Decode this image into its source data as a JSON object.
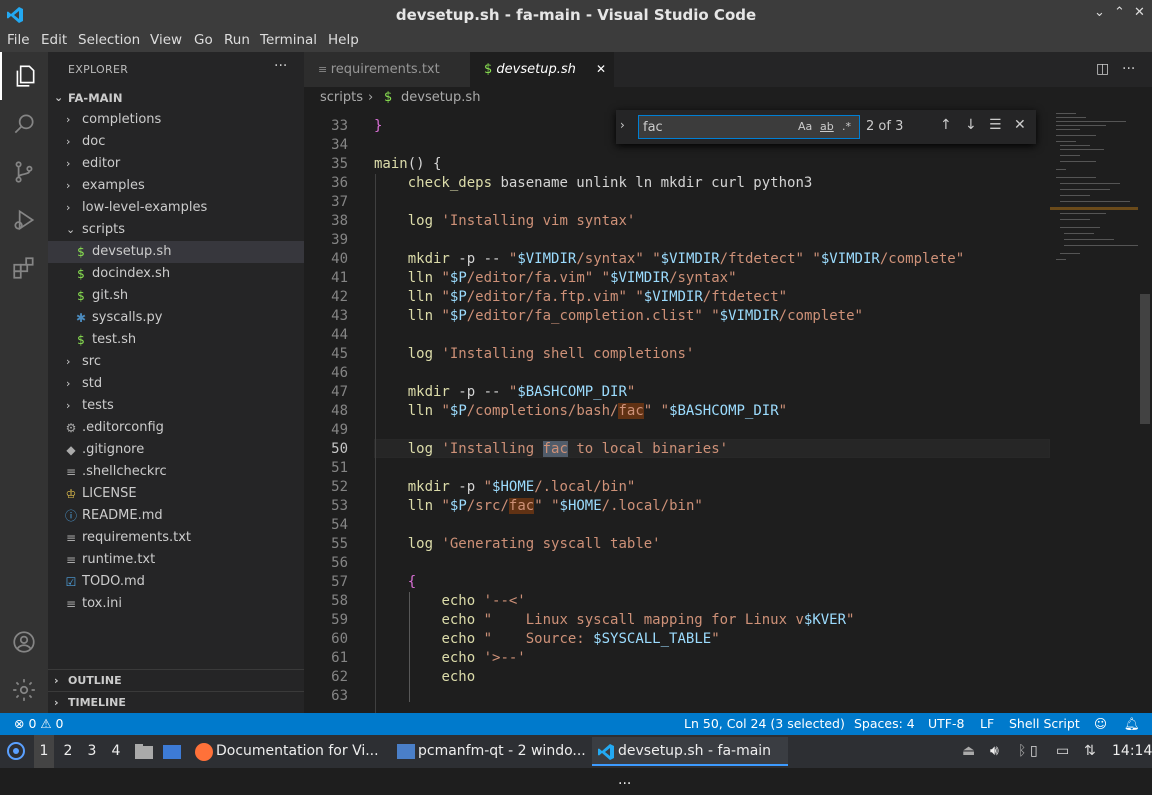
{
  "window": {
    "title": "devsetup.sh - fa-main - Visual Studio Code",
    "controls": [
      "⌄",
      "⌃",
      "✕"
    ]
  },
  "menu": [
    "File",
    "Edit",
    "Selection",
    "View",
    "Go",
    "Run",
    "Terminal",
    "Help"
  ],
  "sidebar": {
    "header": "EXPLORER",
    "more": "···",
    "root": "FA-MAIN",
    "items": [
      {
        "label": "completions",
        "type": "folder",
        "open": false
      },
      {
        "label": "doc",
        "type": "folder",
        "open": false
      },
      {
        "label": "editor",
        "type": "folder",
        "open": false
      },
      {
        "label": "examples",
        "type": "folder",
        "open": false
      },
      {
        "label": "low-level-examples",
        "type": "folder",
        "open": false
      },
      {
        "label": "scripts",
        "type": "folder",
        "open": true
      },
      {
        "label": "devsetup.sh",
        "type": "sh",
        "selected": true
      },
      {
        "label": "docindex.sh",
        "type": "sh"
      },
      {
        "label": "git.sh",
        "type": "sh"
      },
      {
        "label": "syscalls.py",
        "type": "py"
      },
      {
        "label": "test.sh",
        "type": "sh"
      },
      {
        "label": "src",
        "type": "folder",
        "open": false
      },
      {
        "label": "std",
        "type": "folder",
        "open": false
      },
      {
        "label": "tests",
        "type": "folder",
        "open": false
      },
      {
        "label": ".editorconfig",
        "type": "gear"
      },
      {
        "label": ".gitignore",
        "type": "git"
      },
      {
        "label": ".shellcheckrc",
        "type": "lines"
      },
      {
        "label": "LICENSE",
        "type": "license"
      },
      {
        "label": "README.md",
        "type": "info"
      },
      {
        "label": "requirements.txt",
        "type": "lines"
      },
      {
        "label": "runtime.txt",
        "type": "lines"
      },
      {
        "label": "TODO.md",
        "type": "check"
      },
      {
        "label": "tox.ini",
        "type": "lines"
      }
    ],
    "outline": "OUTLINE",
    "timeline": "TIMELINE"
  },
  "tabs": [
    {
      "label": "requirements.txt",
      "active": false
    },
    {
      "label": "devsetup.sh",
      "active": true,
      "close": "✕"
    }
  ],
  "breadcrumb": {
    "folder": "scripts",
    "sep": "›",
    "file": "devsetup.sh"
  },
  "find": {
    "value": "fac",
    "count": "2 of 3",
    "case": "Aa",
    "word": "ab",
    "regex": ".*"
  },
  "editor": {
    "current_line": 50,
    "lines": [
      {
        "n": "33",
        "t": "}"
      },
      {
        "n": "34",
        "t": ""
      },
      {
        "n": "35",
        "t": "main() {"
      },
      {
        "n": "36",
        "t": "    check_deps basename unlink ln mkdir curl python3"
      },
      {
        "n": "37",
        "t": ""
      },
      {
        "n": "38",
        "t": "    log 'Installing vim syntax'"
      },
      {
        "n": "39",
        "t": ""
      },
      {
        "n": "40",
        "t": "    mkdir -p -- \"$VIMDIR/syntax\" \"$VIMDIR/ftdetect\" \"$VIMDIR/complete\""
      },
      {
        "n": "41",
        "t": "    lln \"$P/editor/fa.vim\" \"$VIMDIR/syntax\""
      },
      {
        "n": "42",
        "t": "    lln \"$P/editor/fa.ftp.vim\" \"$VIMDIR/ftdetect\""
      },
      {
        "n": "43",
        "t": "    lln \"$P/editor/fa_completion.clist\" \"$VIMDIR/complete\""
      },
      {
        "n": "44",
        "t": ""
      },
      {
        "n": "45",
        "t": "    log 'Installing shell completions'"
      },
      {
        "n": "46",
        "t": ""
      },
      {
        "n": "47",
        "t": "    mkdir -p -- \"$BASHCOMP_DIR\""
      },
      {
        "n": "48",
        "t": "    lln \"$P/completions/bash/fac\" \"$BASHCOMP_DIR\""
      },
      {
        "n": "49",
        "t": ""
      },
      {
        "n": "50",
        "t": "    log 'Installing fac to local binaries'"
      },
      {
        "n": "51",
        "t": ""
      },
      {
        "n": "52",
        "t": "    mkdir -p \"$HOME/.local/bin\""
      },
      {
        "n": "53",
        "t": "    lln \"$P/src/fac\" \"$HOME/.local/bin\""
      },
      {
        "n": "54",
        "t": ""
      },
      {
        "n": "55",
        "t": "    log 'Generating syscall table'"
      },
      {
        "n": "56",
        "t": ""
      },
      {
        "n": "57",
        "t": "    {"
      },
      {
        "n": "58",
        "t": "        echo '--<'"
      },
      {
        "n": "59",
        "t": "        echo \"    Linux syscall mapping for Linux v$KVER\""
      },
      {
        "n": "60",
        "t": "        echo \"    Source: $SYSCALL_TABLE\""
      },
      {
        "n": "61",
        "t": "        echo '>--'"
      },
      {
        "n": "62",
        "t": "        echo"
      },
      {
        "n": "63",
        "t": ""
      }
    ]
  },
  "status": {
    "remote": "⛒",
    "problems": "⊗ 0 ⚠ 0",
    "position": "Ln 50, Col 24 (3 selected)",
    "spaces": "Spaces: 4",
    "encoding": "UTF-8",
    "eol": "LF",
    "language": "Shell Script"
  },
  "taskbar": {
    "workspaces": [
      "1",
      "2",
      "3",
      "4"
    ],
    "windows": [
      {
        "label": "Documentation for Vi...",
        "active": false
      },
      {
        "label": "pcmanfm-qt - 2 windo...",
        "active": false
      },
      {
        "label": "devsetup.sh - fa-main ...",
        "active": true
      }
    ],
    "clock": "14:14"
  },
  "colors": {
    "accent": "#007acc",
    "match": "#613214",
    "current_match": "#515c6a"
  }
}
